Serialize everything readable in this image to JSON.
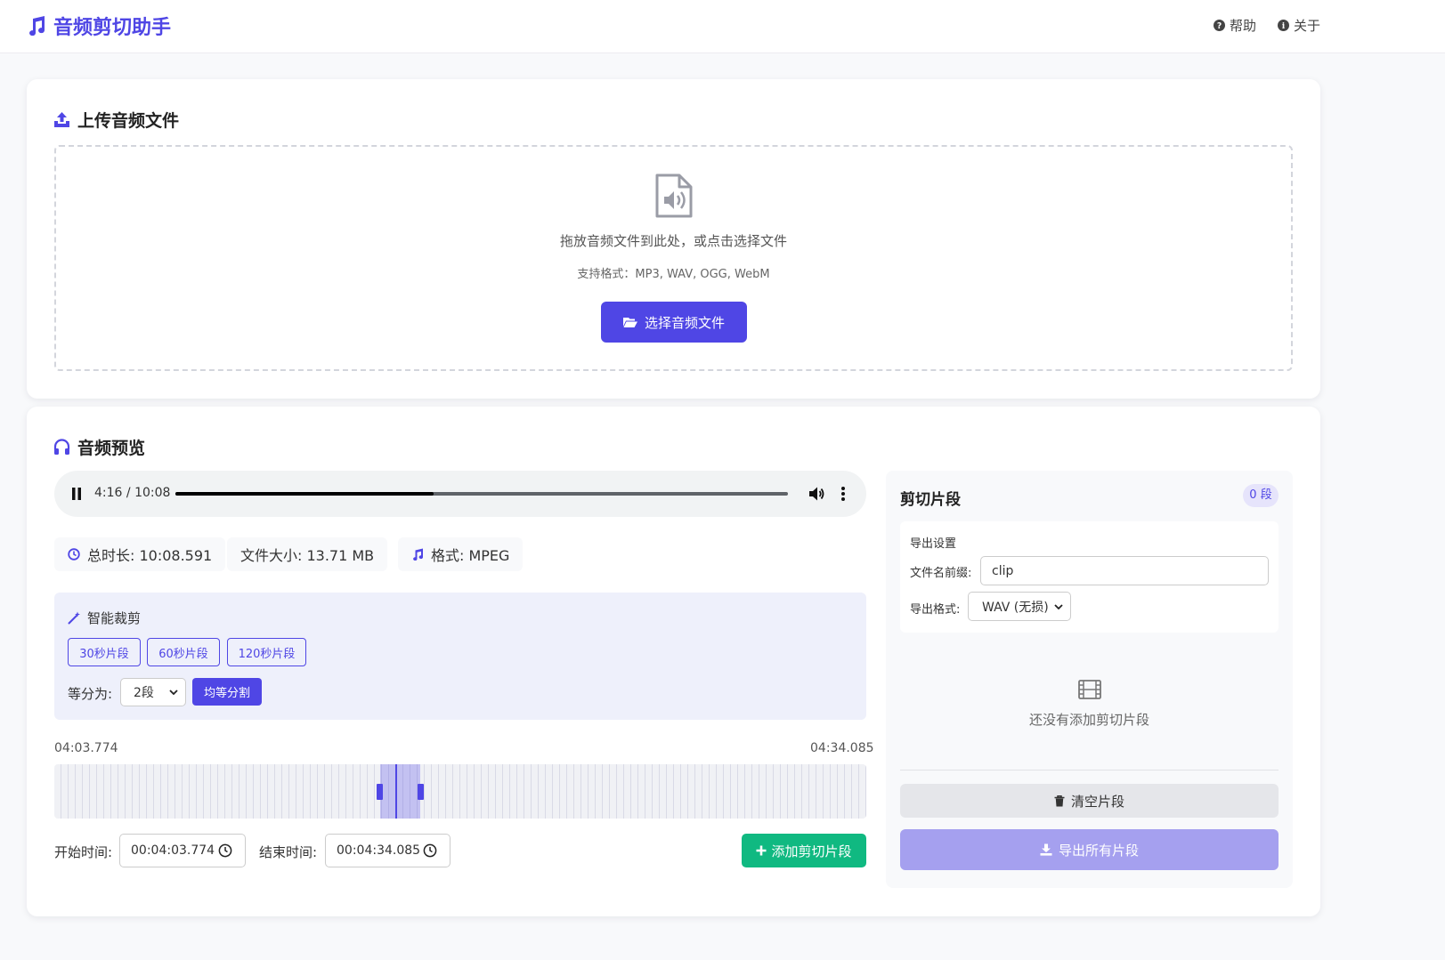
{
  "app": {
    "title": "音频剪切助手",
    "logo_icon": "music-note-icon",
    "accent_color": "#4f46e5"
  },
  "nav": [
    {
      "label": "帮助",
      "icon": "question-circle-icon"
    },
    {
      "label": "关于",
      "icon": "info-circle-icon"
    }
  ],
  "upload": {
    "title": "上传音频文件",
    "title_icon": "upload-icon",
    "drop_text": "拖放音频文件到此处，或点击选择文件",
    "formats_text": "支持格式：MP3, WAV, OGG, WebM",
    "button_label": "选择音频文件"
  },
  "preview": {
    "title": "音频预览",
    "player": {
      "current_time": "4:16",
      "duration": "10:08",
      "progress_fraction": 0.421
    },
    "info": {
      "duration": "总时长: 10:08.591",
      "size": "文件大小: 13.71 MB",
      "format": "格式: MPEG"
    },
    "smart_cut": {
      "title": "智能裁剪",
      "presets": [
        "30秒片段",
        "60秒片段",
        "120秒片段"
      ],
      "split_label": "等分为:",
      "split_value": "2段",
      "split_button": "均等分割"
    },
    "range": {
      "start_label": "04:03.774",
      "end_label": "04:34.085"
    },
    "timeline": {
      "selection_start_fraction": 0.401,
      "selection_end_fraction": 0.451,
      "cursor_fraction": 0.421
    },
    "time_inputs": {
      "start_label": "开始时间:",
      "start_value": "00:04:03.774",
      "end_label": "结束时间:",
      "end_value": "00:04:34.085"
    },
    "add_button": "添加剪切片段"
  },
  "clips": {
    "title": "剪切片段",
    "count_badge": "0 段",
    "export_settings_title": "导出设置",
    "prefix_label": "文件名前缀:",
    "prefix_value": "clip",
    "format_label": "导出格式:",
    "format_value": "WAV (无损)",
    "empty_text": "还没有添加剪切片段",
    "clear_button": "清空片段",
    "export_button": "导出所有片段"
  },
  "colors": {
    "primary": "#4f46e5",
    "success": "#10b981",
    "disabled": "#a5a0ef"
  }
}
